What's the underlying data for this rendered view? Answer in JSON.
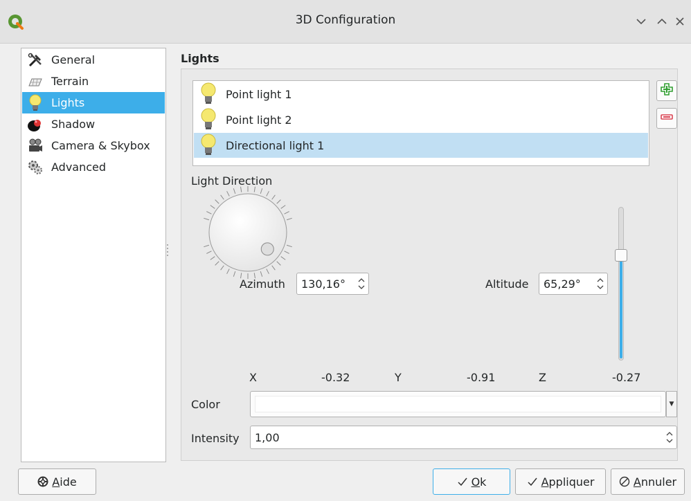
{
  "window": {
    "title": "3D Configuration"
  },
  "sidebar": {
    "items": [
      {
        "label": "General",
        "icon": "general-tools-icon"
      },
      {
        "label": "Terrain",
        "icon": "terrain-icon"
      },
      {
        "label": "Lights",
        "icon": "lightbulb-icon",
        "selected": true
      },
      {
        "label": "Shadow",
        "icon": "shadow-icon"
      },
      {
        "label": "Camera & Skybox",
        "icon": "camera-icon"
      },
      {
        "label": "Advanced",
        "icon": "advanced-icon"
      }
    ]
  },
  "lights": {
    "section_title": "Lights",
    "items": [
      {
        "label": "Point light 1",
        "icon": "lightbulb-icon"
      },
      {
        "label": "Point light 2",
        "icon": "lightbulb-icon"
      },
      {
        "label": "Directional light 1",
        "icon": "lightbulb-icon",
        "selected": true
      }
    ],
    "add_icon": "add-light-icon",
    "remove_icon": "remove-light-icon"
  },
  "direction": {
    "title": "Light Direction",
    "azimuth_label": "Azimuth",
    "azimuth_value": "130,16°",
    "altitude_label": "Altitude",
    "altitude_value": "65,29°",
    "altitude_slider_fraction": 0.725,
    "dial_azimuth_deg": 130.16,
    "x_label": "X",
    "x_value": "-0.32",
    "y_label": "Y",
    "y_value": "-0.91",
    "z_label": "Z",
    "z_value": "-0.27"
  },
  "color": {
    "label": "Color",
    "value": "#ffffff"
  },
  "intensity": {
    "label": "Intensity",
    "value": "1,00"
  },
  "buttons": {
    "help_mnemonic": "A",
    "help_rest": "ide",
    "ok_mnemonic": "O",
    "ok_rest": "k",
    "apply_mnemonic": "A",
    "apply_rest": "ppliquer",
    "cancel_mnemonic": "A",
    "cancel_rest": "nnuler"
  },
  "colors": {
    "accent": "#3daee9",
    "selection_light": "#c1dff3",
    "add_green": "#2f9e2f",
    "remove_red": "#da4453"
  }
}
